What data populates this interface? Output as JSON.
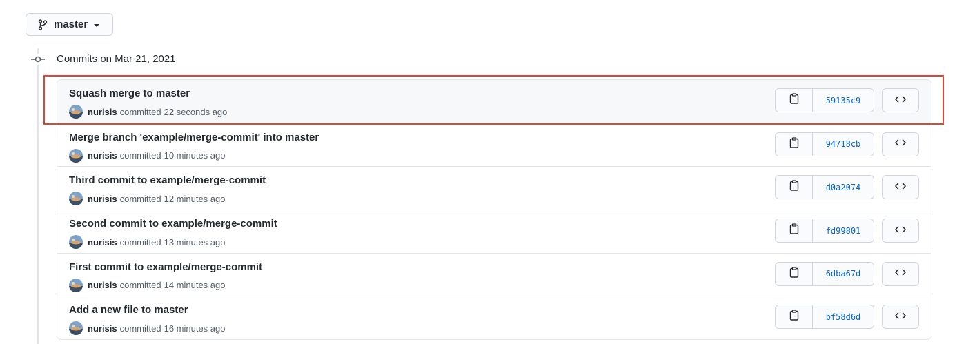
{
  "branch": {
    "name": "master",
    "icon": "git-branch-icon"
  },
  "group": {
    "heading": "Commits on Mar 21, 2021",
    "icon": "git-commit-icon"
  },
  "commits": [
    {
      "title": "Squash merge to master",
      "author": "nurisis",
      "verb": "committed",
      "time": "22 seconds ago",
      "sha": "59135c9",
      "highlighted": true
    },
    {
      "title": "Merge branch 'example/merge-commit' into master",
      "author": "nurisis",
      "verb": "committed",
      "time": "10 minutes ago",
      "sha": "94718cb"
    },
    {
      "title": "Third commit to example/merge-commit",
      "author": "nurisis",
      "verb": "committed",
      "time": "12 minutes ago",
      "sha": "d0a2074"
    },
    {
      "title": "Second commit to example/merge-commit",
      "author": "nurisis",
      "verb": "committed",
      "time": "13 minutes ago",
      "sha": "fd99801"
    },
    {
      "title": "First commit to example/merge-commit",
      "author": "nurisis",
      "verb": "committed",
      "time": "14 minutes ago",
      "sha": "6dba67d"
    },
    {
      "title": "Add a new file to master",
      "author": "nurisis",
      "verb": "committed",
      "time": "16 minutes ago",
      "sha": "bf58d6d"
    }
  ],
  "icons": {
    "copy": "clipboard-icon",
    "browse": "code-icon",
    "caret": "caret-down-icon"
  },
  "colors": {
    "link": "#0366d6",
    "highlight": "#e4442f",
    "border": "#e1e4e8"
  }
}
